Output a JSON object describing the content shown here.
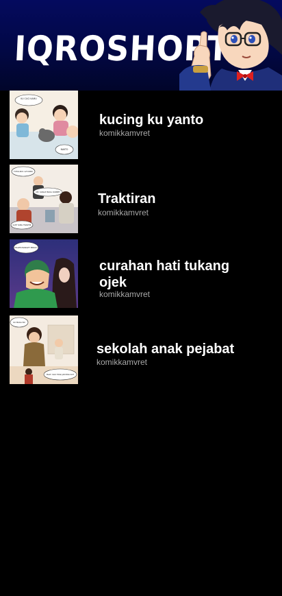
{
  "header": {
    "app_title": "IQROSHORT",
    "mascot_icon": "detective-boy-mascot",
    "bg_color": "#020845"
  },
  "comics": [
    {
      "title": "kucing ku yanto",
      "author": "komikkamvret",
      "thumb_icon": "comic-thumbnail-kids-cat",
      "bubbles": [
        "KU CUCI KAMU",
        "NAKTO"
      ]
    },
    {
      "title": "Traktiran",
      "author": "komikkamvret",
      "thumb_icon": "comic-thumbnail-friends-table",
      "bubbles": [
        "TOTALNYA 125 RIBU",
        "IIIH, SOSIAH BUKA DOMPET",
        "GUE YANG TRAKTIR"
      ]
    },
    {
      "title": "curahan hati tukang ojek",
      "author": "komikkamvret",
      "thumb_icon": "comic-thumbnail-ojek-driver",
      "bubbles": [
        "MALEM BANGET MBAK?"
      ]
    },
    {
      "title": "sekolah anak pejabat",
      "author": "komikkamvret",
      "thumb_icon": "comic-thumbnail-official-school",
      "bubbles": [
        "KU MAKA BU",
        "MAAF, SAYA TIDAK JADI BISA IKUT"
      ]
    }
  ]
}
